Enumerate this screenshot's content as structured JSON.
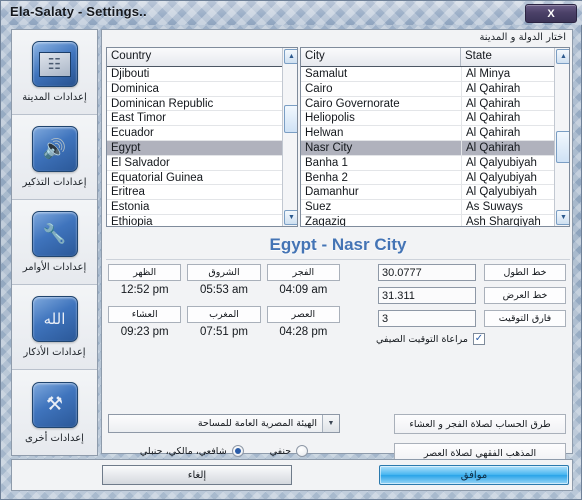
{
  "window": {
    "title": "Ela-Salaty - Settings..",
    "close_label": "X"
  },
  "sidebar": {
    "items": [
      {
        "label": "إعدادات المدينة",
        "icon": "globe-icon"
      },
      {
        "label": "إعدادات التذكير",
        "icon": "speaker-icon"
      },
      {
        "label": "إعدادات الأوامر",
        "icon": "wrench-icon"
      },
      {
        "label": "إعدادات الأذكار",
        "icon": "allah-icon"
      },
      {
        "label": "إعدادات أخرى",
        "icon": "tools-icon"
      }
    ]
  },
  "main": {
    "heading": "اختار الدولة و المدينة",
    "location_title": "Egypt - Nasr City",
    "country_list": {
      "header": "Country",
      "rows": [
        "Djibouti",
        "Dominica",
        "Dominican Republic",
        "East Timor",
        "Ecuador",
        "Egypt",
        "El Salvador",
        "Equatorial Guinea",
        "Eritrea",
        "Estonia",
        "Ethiopia"
      ],
      "selected_index": 5
    },
    "city_list": {
      "headers": [
        "City",
        "State"
      ],
      "rows": [
        {
          "city": "Samalut",
          "state": "Al Minya"
        },
        {
          "city": "Cairo",
          "state": "Al Qahirah"
        },
        {
          "city": "Cairo Governorate",
          "state": "Al Qahirah"
        },
        {
          "city": "Heliopolis",
          "state": "Al Qahirah"
        },
        {
          "city": "Helwan",
          "state": "Al Qahirah"
        },
        {
          "city": "Nasr City",
          "state": "Al Qahirah"
        },
        {
          "city": "Banha 1",
          "state": "Al Qalyubiyah"
        },
        {
          "city": "Benha 2",
          "state": "Al Qalyubiyah"
        },
        {
          "city": "Damanhur",
          "state": "Al Qalyubiyah"
        },
        {
          "city": "Suez",
          "state": "As Suways"
        },
        {
          "city": "Zagazig",
          "state": "Ash Sharqiyah"
        }
      ],
      "selected_index": 5
    },
    "prayers": [
      {
        "label": "الظهر",
        "time": "12:52 pm"
      },
      {
        "label": "الشروق",
        "time": "05:53 am"
      },
      {
        "label": "الفجر",
        "time": "04:09 am"
      },
      {
        "label": "العشاء",
        "time": "09:23 pm"
      },
      {
        "label": "المغرب",
        "time": "07:51 pm"
      },
      {
        "label": "العصر",
        "time": "04:28 pm"
      }
    ],
    "coords": [
      {
        "label": "خط الطول",
        "value": "30.0777"
      },
      {
        "label": "خط العرض",
        "value": "31.311"
      },
      {
        "label": "فارق التوقيت",
        "value": "3"
      }
    ],
    "dst": {
      "label": "مراعاة التوقيت الصيفي",
      "checked": true,
      "check_glyph": "✓"
    },
    "method": {
      "value": "الهيئة المصرية العامة للمساحة",
      "arrow": "▼"
    },
    "madhhab": [
      {
        "label": "حنفي",
        "selected": false
      },
      {
        "label": "شافعي، مالكي، حنبلي",
        "selected": true
      }
    ],
    "action_buttons": {
      "fajr_isha": "طرق الحساب لصلاة الفجر و العشاء",
      "asr": "المذهب الفقهي لصلاة العصر"
    }
  },
  "footer": {
    "cancel": "إلغاء",
    "ok": "موافق"
  },
  "scroll": {
    "up_glyph": "▲",
    "down_glyph": "▼"
  },
  "colors": {
    "accent": "#4474b5",
    "ok_button": "#29a4e8",
    "selection": "#b0b2bd"
  }
}
